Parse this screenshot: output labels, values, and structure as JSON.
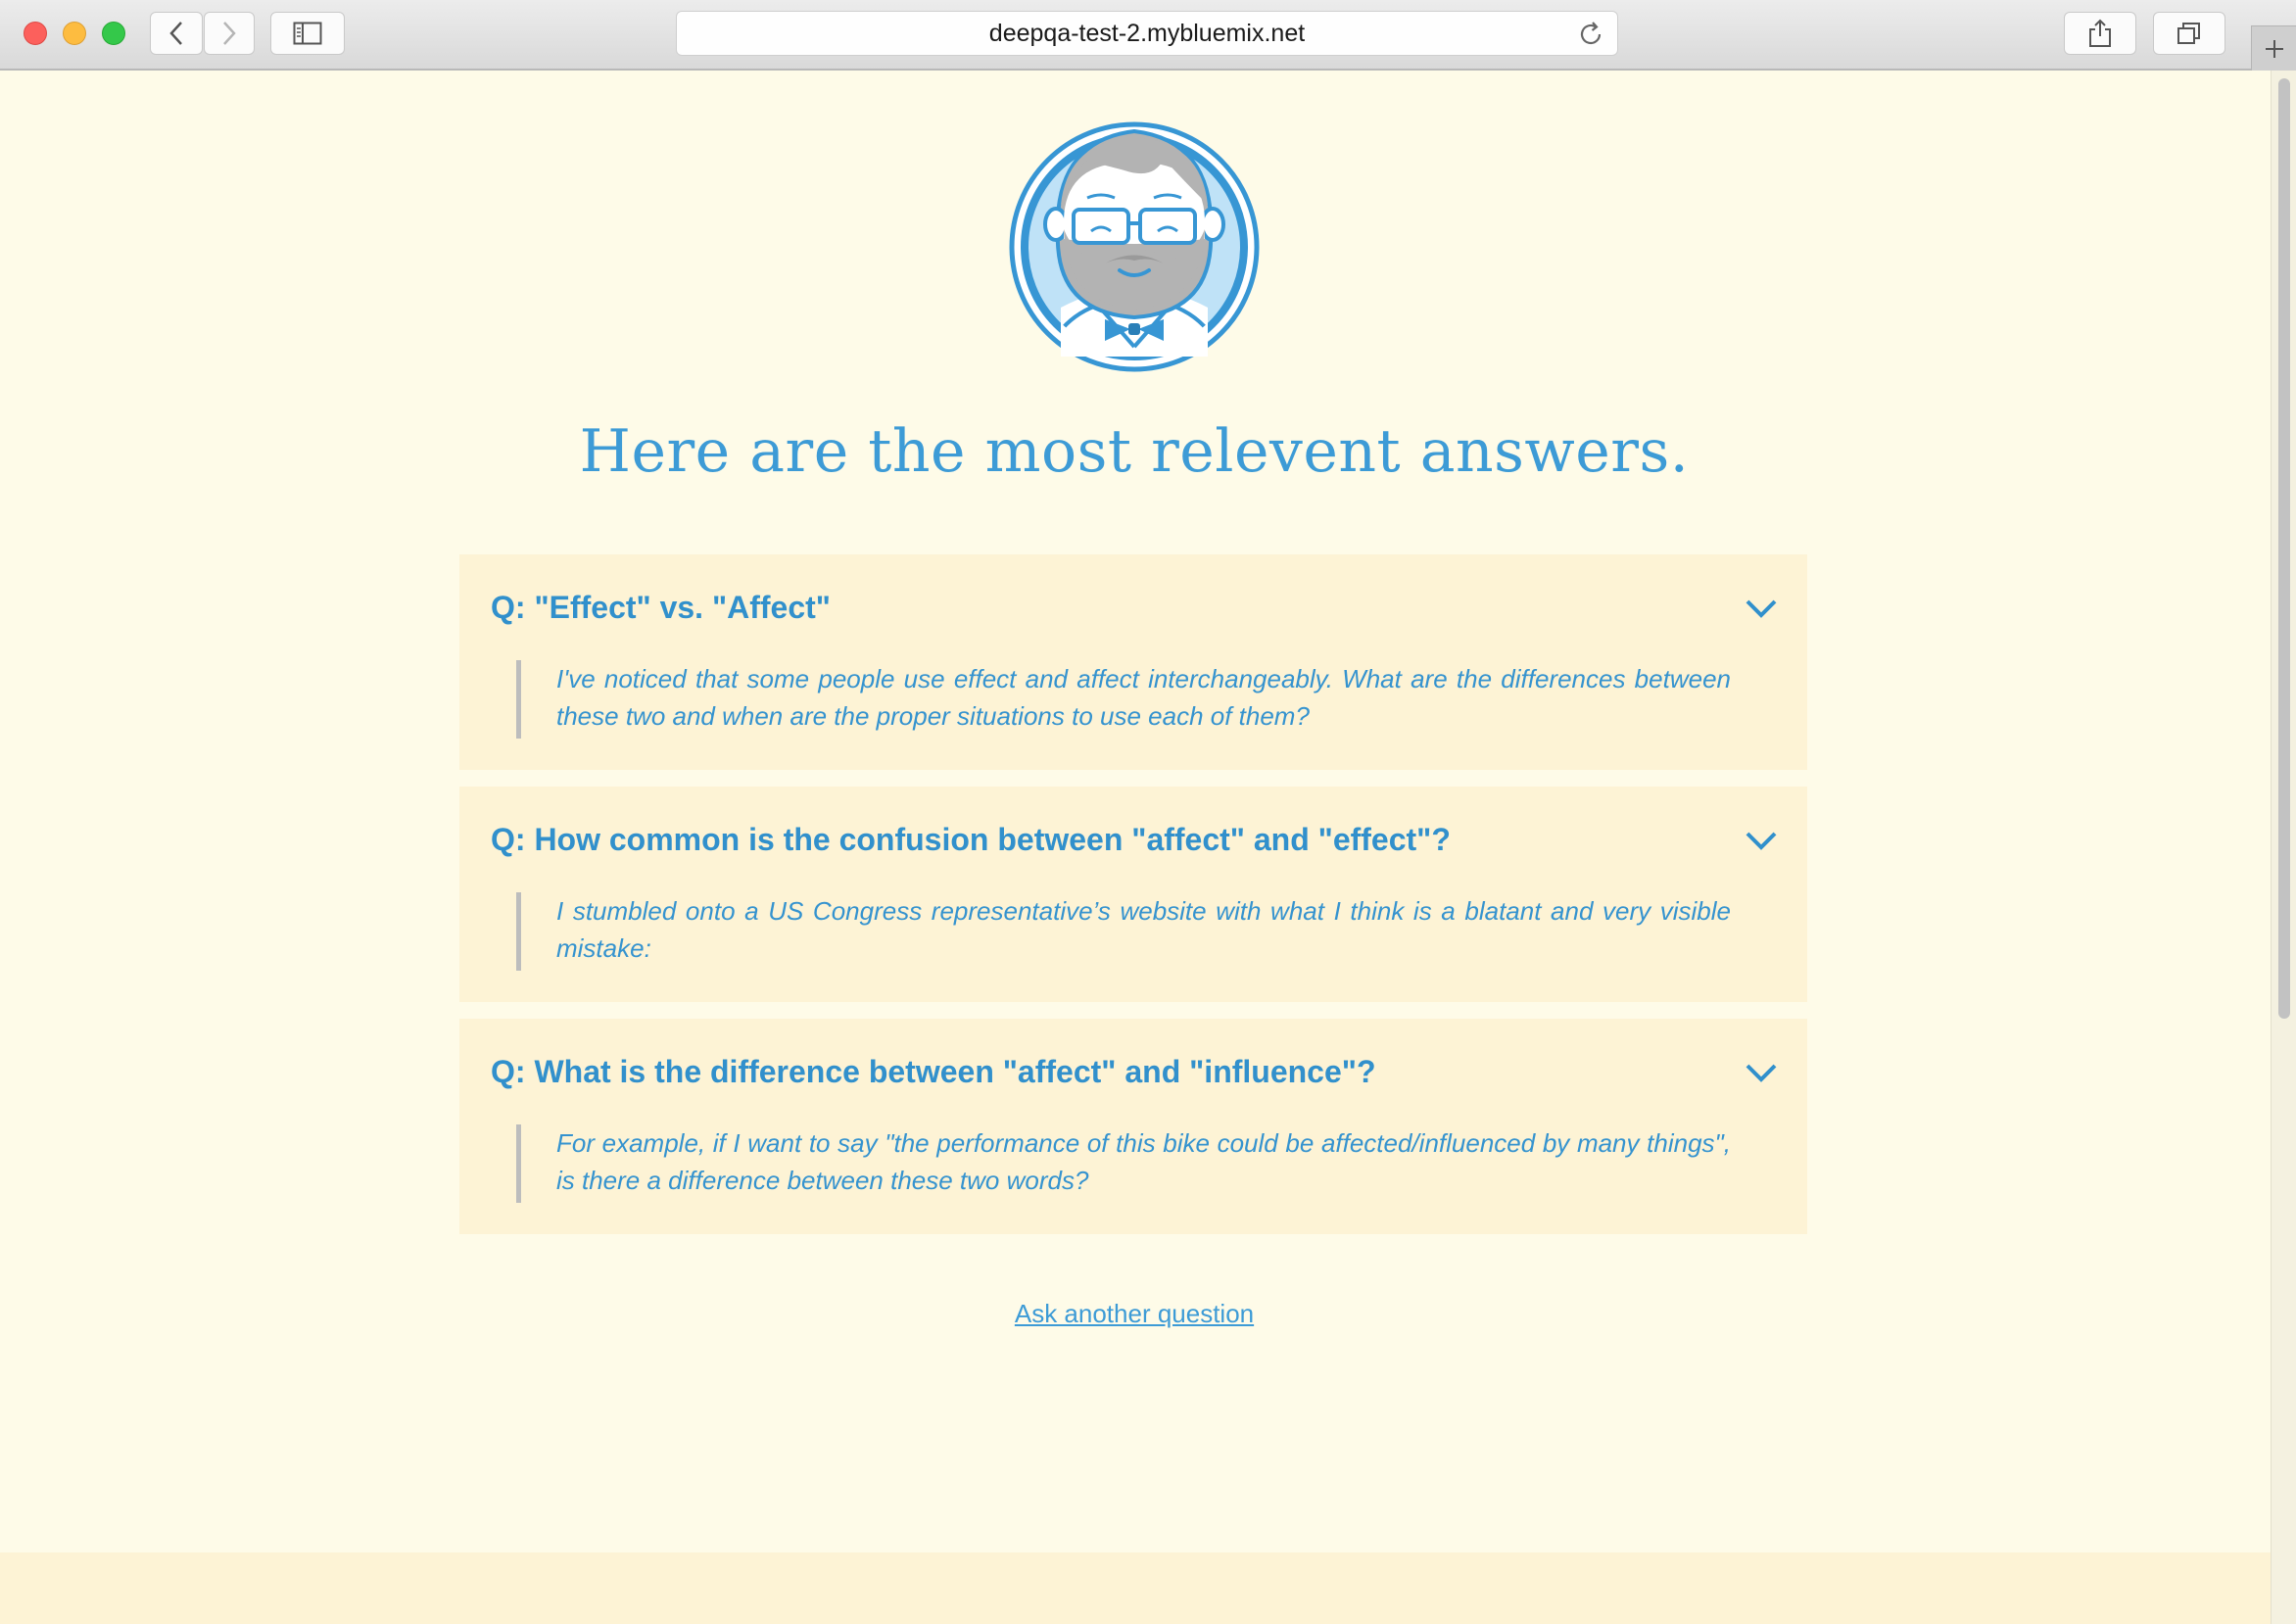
{
  "browser": {
    "url": "deepqa-test-2.mybluemix.net",
    "icons": {
      "back": "chevron-left-icon",
      "forward": "chevron-right-icon",
      "sidebar": "sidebar-icon",
      "reload": "reload-icon",
      "share": "share-icon",
      "tabs": "tabs-icon",
      "new_tab": "plus-icon"
    }
  },
  "page": {
    "headline": "Here are the most relevent answers.",
    "ask_link": "Ask another question",
    "colors": {
      "background": "#fefbe8",
      "card": "#fdf3d5",
      "accent": "#3d9bd6"
    }
  },
  "answers": [
    {
      "question": "Q: \"Effect\" vs. \"Affect\"",
      "excerpt": "I've noticed that some people use effect and affect interchangeably. What are the differences between these two and when are the proper situations to use each of them?"
    },
    {
      "question": "Q: How common is the confusion between \"affect\" and \"effect\"?",
      "excerpt": "I stumbled onto a US Congress representative’s website with what I think is a blatant and very visible mistake:"
    },
    {
      "question": "Q: What is the difference between \"affect\" and \"influence\"?",
      "excerpt": "For example, if I want to say \"the performance of this bike could be affected/influenced by many things\", is there a difference between these two words?"
    }
  ]
}
